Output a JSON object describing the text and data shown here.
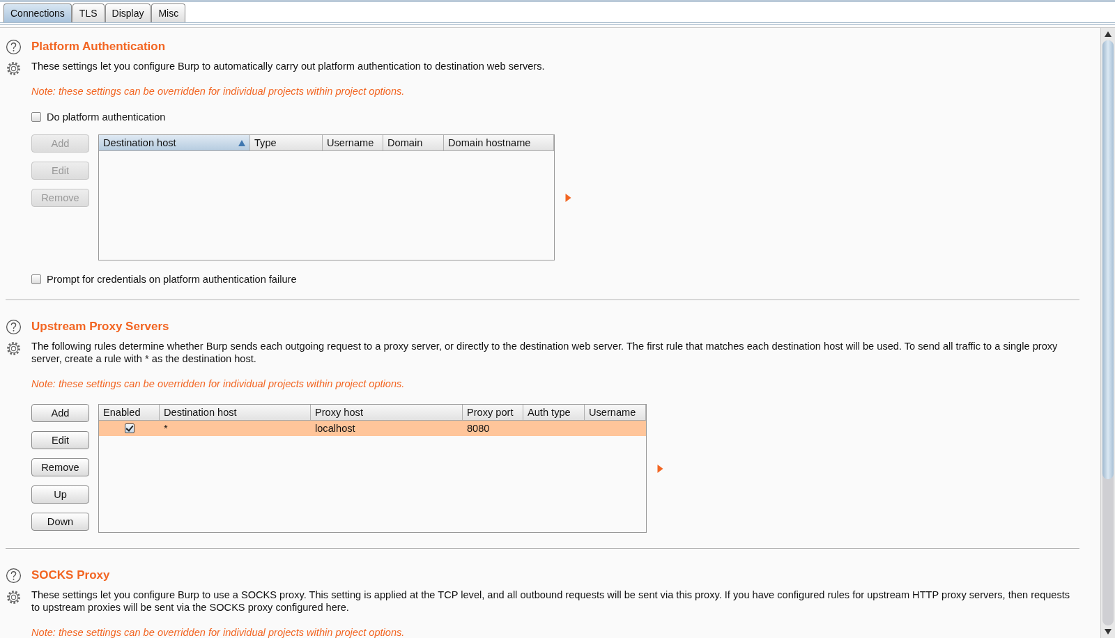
{
  "tabs": [
    {
      "label": "Connections",
      "selected": true
    },
    {
      "label": "TLS",
      "selected": false
    },
    {
      "label": "Display",
      "selected": false
    },
    {
      "label": "Misc",
      "selected": false
    }
  ],
  "sections": [
    {
      "title": "Platform Authentication",
      "description": "These settings let you configure Burp to automatically carry out platform authentication to destination web servers.",
      "note": "Note: these settings can be overridden for individual projects within project options.",
      "options_before": [
        {
          "label": "Do platform authentication",
          "checked": false
        }
      ],
      "buttons": [
        {
          "label": "Add",
          "disabled": true
        },
        {
          "label": "Edit",
          "disabled": true
        },
        {
          "label": "Remove",
          "disabled": true
        }
      ],
      "table": {
        "columns": [
          {
            "label": "Destination host",
            "sorted": true
          },
          {
            "label": "Type",
            "sorted": false
          },
          {
            "label": "Username",
            "sorted": false
          },
          {
            "label": "Domain",
            "sorted": false
          },
          {
            "label": "Domain hostname",
            "sorted": false
          }
        ]
      },
      "options_after": [
        {
          "label": "Prompt for credentials on platform authentication failure",
          "checked": false
        }
      ]
    },
    {
      "title": "Upstream Proxy Servers",
      "description": "The following rules determine whether Burp sends each outgoing request to a proxy server, or directly to the destination web server. The first rule that matches each destination host will be used. To send all traffic to a single proxy server, create a rule with * as the destination host.",
      "note": "Note: these settings can be overridden for individual projects within project options.",
      "buttons": [
        {
          "label": "Add",
          "disabled": false
        },
        {
          "label": "Edit",
          "disabled": false
        },
        {
          "label": "Remove",
          "disabled": false
        },
        {
          "label": "Up",
          "disabled": false
        },
        {
          "label": "Down",
          "disabled": false
        }
      ],
      "table": {
        "columns": [
          {
            "label": "Enabled",
            "sorted": false
          },
          {
            "label": "Destination host",
            "sorted": false
          },
          {
            "label": "Proxy host",
            "sorted": false
          },
          {
            "label": "Proxy port",
            "sorted": false
          },
          {
            "label": "Auth type",
            "sorted": false
          },
          {
            "label": "Username",
            "sorted": false
          }
        ],
        "rows": [
          {
            "checked": true,
            "selected": true,
            "cells": [
              "",
              "*",
              "localhost",
              "8080"
            ]
          }
        ]
      }
    },
    {
      "title": "SOCKS Proxy",
      "description": "These settings let you configure Burp to use a SOCKS proxy. This setting is applied at the TCP level, and all outbound requests will be sent via this proxy. If you have configured rules for upstream HTTP proxy servers, then requests to upstream proxies will be sent via the SOCKS proxy configured here.",
      "note": "Note: these settings can be overridden for individual projects within project options."
    }
  ]
}
